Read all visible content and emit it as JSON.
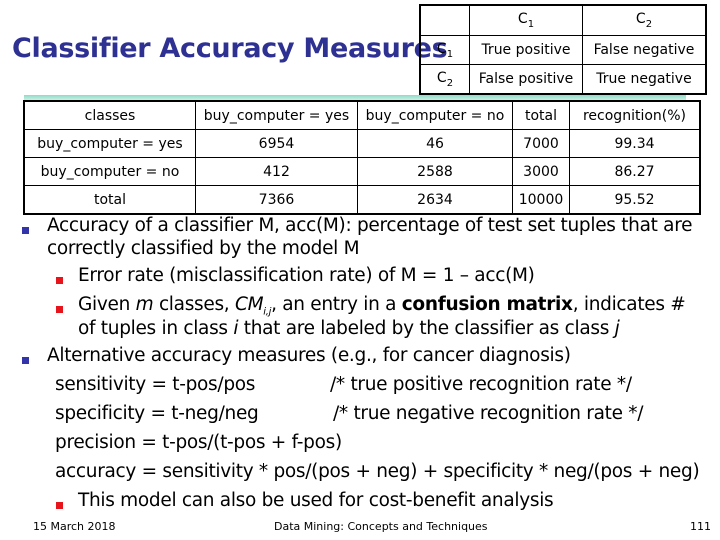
{
  "slide": {
    "title": "Classifier Accuracy Measures",
    "confusion_matrix": {
      "header": [
        "",
        "C1",
        "C2"
      ],
      "header_sub": [
        "",
        "1",
        "2"
      ],
      "rows": [
        {
          "label": "C",
          "label_sub": "1",
          "cells": [
            "True positive",
            "False negative"
          ]
        },
        {
          "label": "C",
          "label_sub": "2",
          "cells": [
            "False positive",
            "True negative"
          ]
        }
      ]
    },
    "accuracy_table": {
      "headers": [
        "classes",
        "buy_computer = yes",
        "buy_computer = no",
        "total",
        "recognition(%)"
      ],
      "rows": [
        [
          "buy_computer = yes",
          "6954",
          "46",
          "7000",
          "99.34"
        ],
        [
          "buy_computer = no",
          "412",
          "2588",
          "3000",
          "86.27"
        ],
        [
          "total",
          "7366",
          "2634",
          "10000",
          "95.52"
        ]
      ]
    },
    "text": {
      "b1_line1": "Accuracy of a classifier M, acc(M): percentage of test set tuples that are",
      "b1_line2": "correctly classified by the model M",
      "b1a": "Error rate (misclassification rate) of M = 1 – acc(M)",
      "b1b_pre": "Given ",
      "b1b_m": "m",
      "b1b_mid": " classes, ",
      "b1b_cm": "CM",
      "b1b_cm_sub": "i,j",
      "b1b_post": ", an entry in a ",
      "b1b_bold": "confusion matrix",
      "b1b_end": ", indicates #",
      "b1b_l2_pre": "of tuples in class ",
      "b1b_l2_i": "i",
      "b1b_l2_mid": " that are labeled by the classifier as class ",
      "b1b_l2_j": "j",
      "b2": "Alternative accuracy measures (e.g., for cancer diagnosis)",
      "sens_formula": "sensitivity = t-pos/pos",
      "sens_comment": "/* true positive recognition rate */",
      "spec_formula": "specificity = t-neg/neg",
      "spec_comment": "/* true negative recognition rate */",
      "precision": "precision =  t-pos/(t-pos + f-pos)",
      "accuracy": "accuracy = sensitivity * pos/(pos + neg) + specificity * neg/(pos + neg)",
      "b2a": "This model can also be used for cost-benefit analysis"
    },
    "footer": {
      "date": "15 March 2018",
      "center": "Data Mining: Concepts and Techniques",
      "page": "111"
    }
  }
}
